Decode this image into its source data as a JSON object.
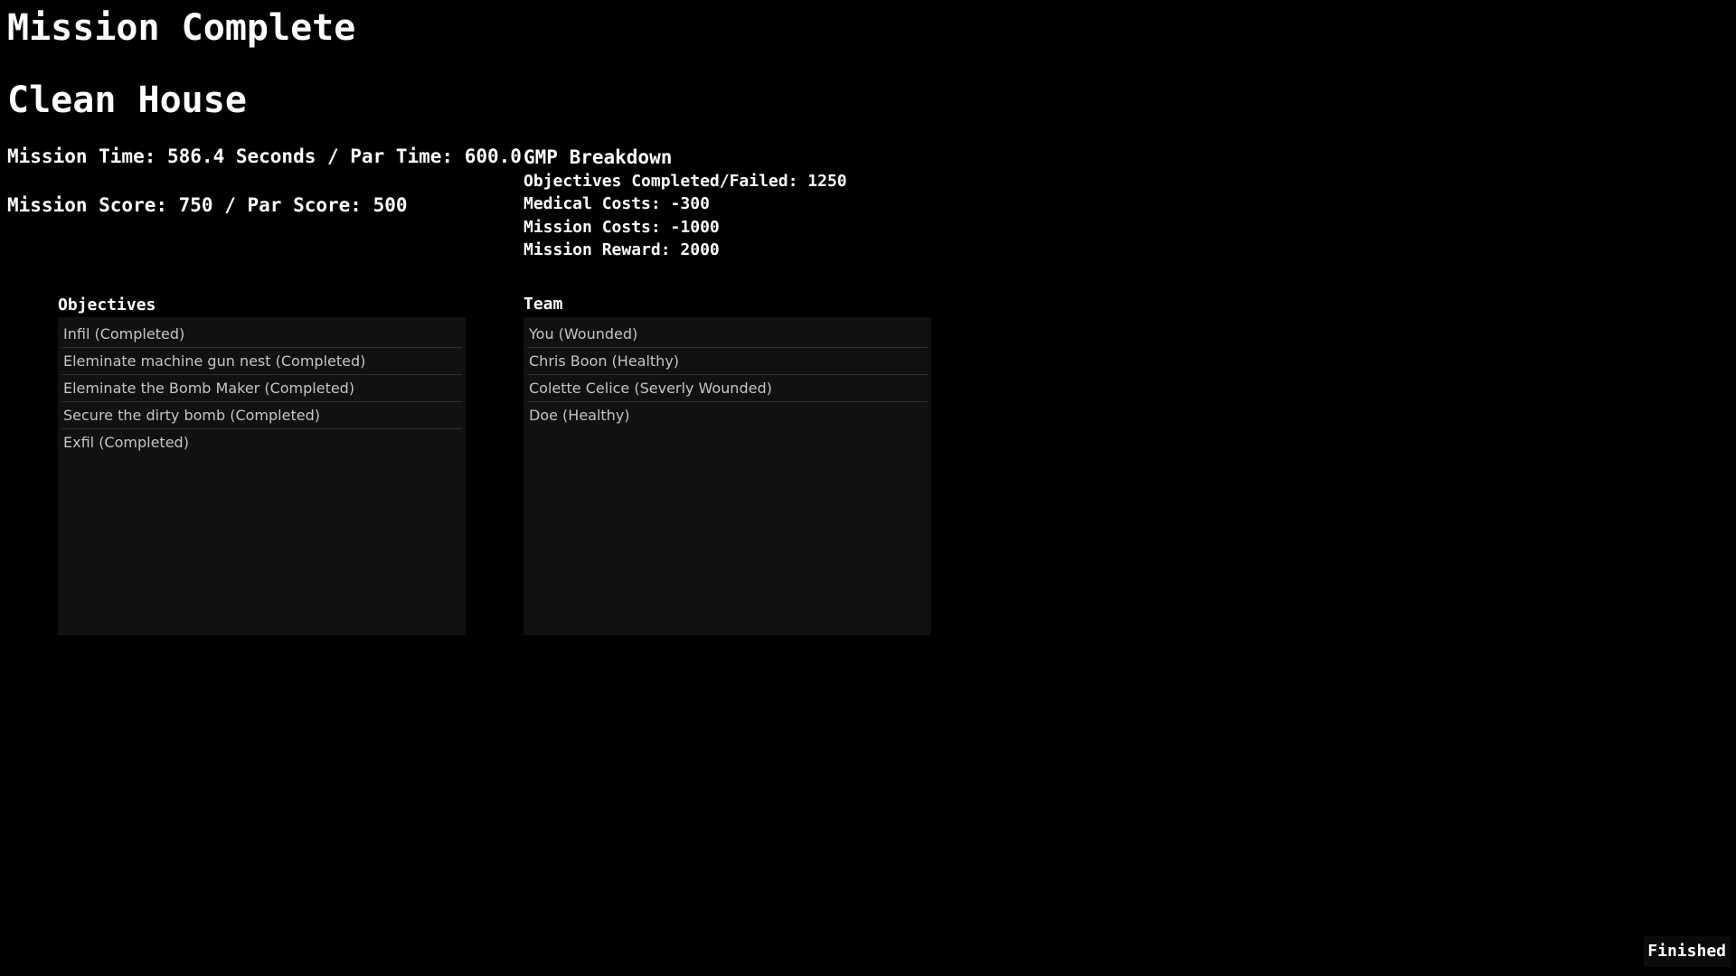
{
  "header": {
    "title": "Mission Complete",
    "mission_name": "Clean House"
  },
  "stats": {
    "time_line": "Mission Time: 586.4 Seconds / Par Time: 600.0",
    "score_line": "Mission Score: 750 / Par Score: 500"
  },
  "gmp": {
    "title": "GMP Breakdown",
    "lines": [
      "Objectives Completed/Failed: 1250",
      "Medical Costs: -300",
      "Mission Costs: -1000",
      "Mission Reward: 2000"
    ]
  },
  "objectives": {
    "label": "Objectives",
    "items": [
      "Infil (Completed)",
      "Eleminate machine gun nest (Completed)",
      "Eleminate the Bomb Maker (Completed)",
      "Secure the dirty bomb (Completed)",
      "Exfil (Completed)"
    ]
  },
  "team": {
    "label": "Team",
    "items": [
      "You (Wounded)",
      "Chris Boon (Healthy)",
      "Colette Celice (Severly Wounded)",
      "Doe (Healthy)"
    ]
  },
  "actions": {
    "finished_label": "Finished"
  }
}
